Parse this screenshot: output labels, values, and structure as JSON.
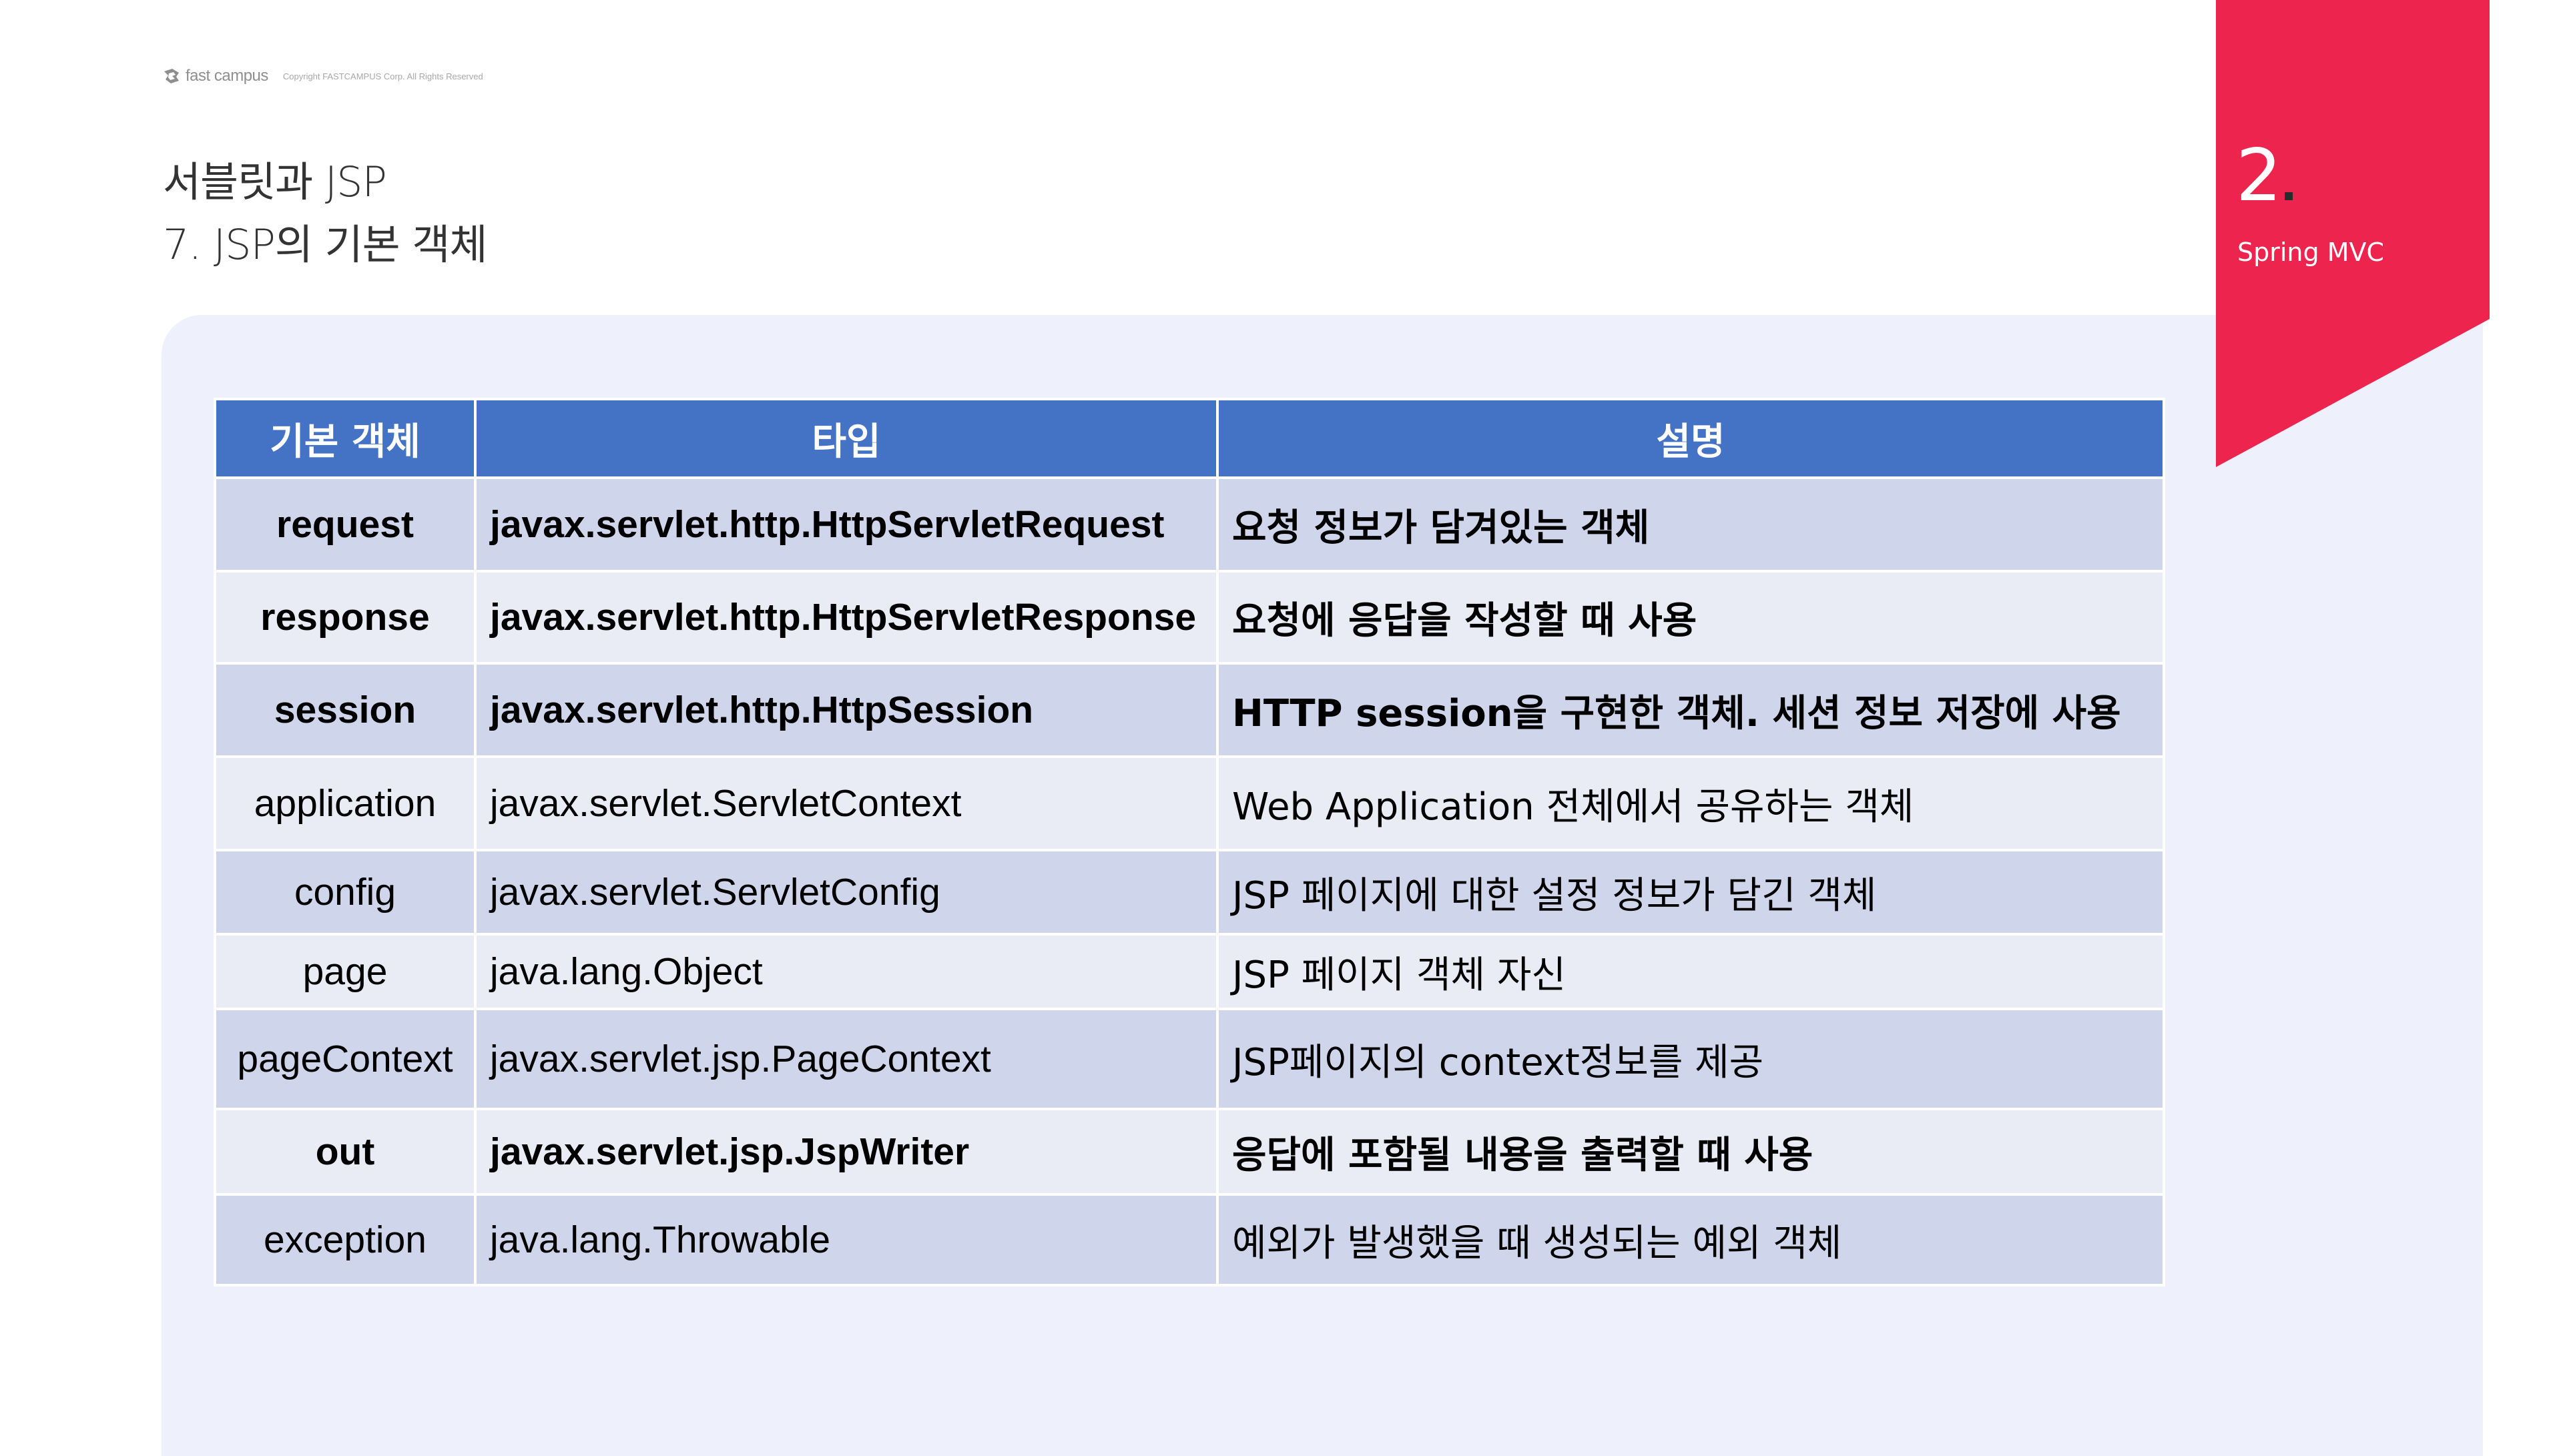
{
  "header": {
    "logo_text": "fast campus",
    "copyright": "Copyright FASTCAMPUS Corp. All Rights Reserved"
  },
  "title": {
    "line1": "서블릿과 JSP",
    "line2": "7. JSP의 기본 객체"
  },
  "section": {
    "number": "2",
    "label": "Spring MVC",
    "accent_color": "#ed254e"
  },
  "table": {
    "headers": [
      "기본 객체",
      "타입",
      "설명"
    ],
    "rows": [
      {
        "object": "request",
        "type": "javax.servlet.http.HttpServletRequest",
        "desc": "요청 정보가 담겨있는 객체"
      },
      {
        "object": "response",
        "type": "javax.servlet.http.HttpServletResponse",
        "desc": "요청에 응답을 작성할 때 사용"
      },
      {
        "object": "session",
        "type": "javax.servlet.http.HttpSession",
        "desc": "HTTP session을 구현한 객체. 세션 정보 저장에 사용"
      },
      {
        "object": "application",
        "type": "javax.servlet.ServletContext",
        "desc": "Web Application 전체에서 공유하는 객체"
      },
      {
        "object": "config",
        "type": "javax.servlet.ServletConfig",
        "desc": "JSP 페이지에 대한 설정 정보가 담긴 객체"
      },
      {
        "object": "page",
        "type": "java.lang.Object",
        "desc": "JSP 페이지 객체 자신"
      },
      {
        "object": "pageContext",
        "type": "javax.servlet.jsp.PageContext",
        "desc": "JSP페이지의 context정보를 제공"
      },
      {
        "object": "out",
        "type": "javax.servlet.jsp.JspWriter",
        "desc": "응답에 포함될 내용을 출력할 때 사용"
      },
      {
        "object": "exception",
        "type": "java.lang.Throwable",
        "desc": "예외가 발생했을 때 생성되는 예외 객체"
      }
    ]
  }
}
